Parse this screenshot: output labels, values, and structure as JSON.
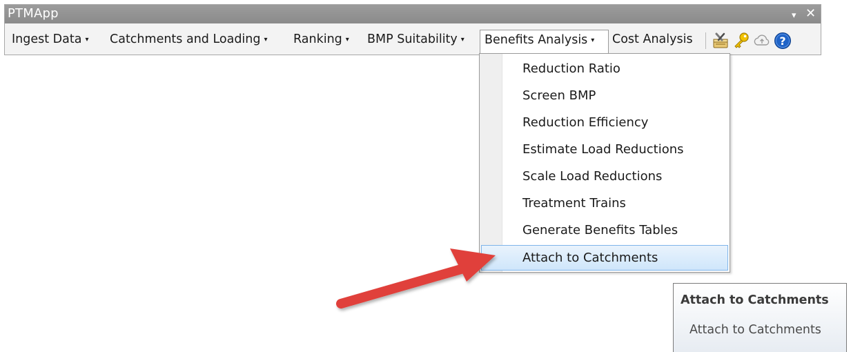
{
  "window": {
    "title": "PTMApp",
    "controls": {
      "dropdown_glyph": "▾",
      "close_glyph": "✕"
    }
  },
  "menubar": {
    "items": [
      {
        "label": "Ingest Data",
        "has_dropdown": true
      },
      {
        "label": "Catchments and Loading",
        "has_dropdown": true
      },
      {
        "label": "Ranking",
        "has_dropdown": true
      },
      {
        "label": "BMP Suitability",
        "has_dropdown": true
      },
      {
        "label": "Benefits Analysis",
        "has_dropdown": true,
        "open": true
      },
      {
        "label": "Cost Analysis",
        "has_dropdown": false
      }
    ],
    "dropdown_arrow": "▾",
    "tools": [
      {
        "icon": "tools-icon"
      },
      {
        "icon": "key-icon"
      },
      {
        "icon": "cloud-icon"
      },
      {
        "icon": "help-icon"
      }
    ]
  },
  "benefits_menu": {
    "items": [
      {
        "label": "Reduction Ratio"
      },
      {
        "label": "Screen BMP"
      },
      {
        "label": "Reduction Efficiency"
      },
      {
        "label": "Estimate Load Reductions"
      },
      {
        "label": "Scale Load Reductions"
      },
      {
        "label": "Treatment Trains"
      },
      {
        "label": "Generate Benefits Tables"
      },
      {
        "label": "Attach to Catchments",
        "highlighted": true
      }
    ]
  },
  "tooltip": {
    "title": "Attach to Catchments",
    "body": "Attach to Catchments"
  },
  "colors": {
    "titlebar": "#8f8f8f",
    "highlight_fill": "#cfe6fb",
    "highlight_border": "#7eb4ea",
    "annotation_arrow": "#e0413a",
    "help_blue": "#1f63c7"
  }
}
